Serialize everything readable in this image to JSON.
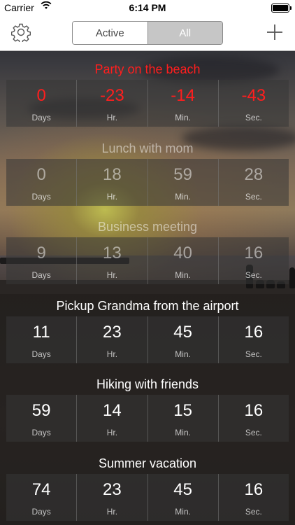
{
  "status": {
    "carrier": "Carrier",
    "time": "6:14 PM"
  },
  "nav": {
    "segments": [
      "Active",
      "All"
    ],
    "selected": "Active"
  },
  "colors": {
    "past": "#ff1e1e",
    "future": "#ffffff",
    "accent": "#ffffff"
  },
  "units": {
    "days": "Days",
    "hr": "Hr.",
    "min": "Min.",
    "sec": "Sec."
  },
  "events": [
    {
      "title": "Party on the beach",
      "days": "0",
      "hr": "-23",
      "min": "-14",
      "sec": "-43"
    },
    {
      "title": "Lunch with mom",
      "days": "0",
      "hr": "18",
      "min": "59",
      "sec": "28"
    },
    {
      "title": "Business meeting",
      "days": "9",
      "hr": "13",
      "min": "40",
      "sec": "16"
    },
    {
      "title": "Pickup Grandma from the airport",
      "days": "11",
      "hr": "23",
      "min": "45",
      "sec": "16"
    },
    {
      "title": "Hiking with friends",
      "days": "59",
      "hr": "14",
      "min": "15",
      "sec": "16"
    },
    {
      "title": "Summer vacation",
      "days": "74",
      "hr": "23",
      "min": "45",
      "sec": "16"
    }
  ]
}
